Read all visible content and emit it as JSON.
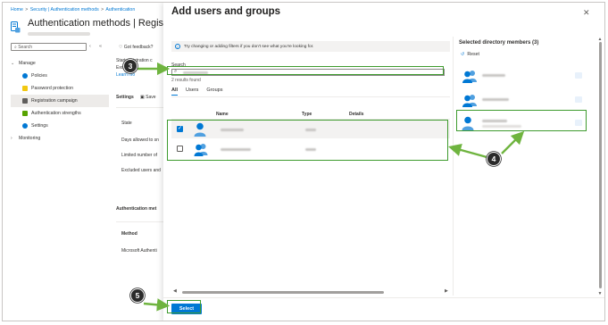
{
  "breadcrumb": {
    "home": "Home",
    "security": "Security | Authentication methods",
    "auth": "Authentication"
  },
  "page": {
    "title": "Authentication methods | Regist",
    "search_placeholder": "Search",
    "feedback": "Got feedback?"
  },
  "nav": {
    "manage": "Manage",
    "policies": "Policies",
    "password_protection": "Password protection",
    "registration_campaign": "Registration campaign",
    "authentication_strengths": "Authentication strengths",
    "settings": "Settings",
    "monitoring": "Monitoring"
  },
  "background": {
    "start_text": "Start registration c",
    "exclude_text": "Exclud",
    "learn_more": "Learn mo",
    "settings": "Settings",
    "save": "Save",
    "state": "State",
    "days_allowed": "Days allowed to sn",
    "limited_number": "Limited number of",
    "excluded_users": "Excluded users and",
    "auth_methods": "Authentication met",
    "method": "Method",
    "microsoft_authenticator": "Microsoft Authenti"
  },
  "dialog": {
    "title": "Add users and groups",
    "info": "Try changing or adding filters if you don't see what you're looking for.",
    "search_label": "Search",
    "results": "2 results found",
    "tabs": [
      "All",
      "Users",
      "Groups"
    ],
    "columns": {
      "name": "Name",
      "type": "Type",
      "details": "Details"
    },
    "selected_title": "Selected directory members (3)",
    "reset": "Reset",
    "select_button": "Select",
    "close_icon": "close-icon"
  },
  "annotations": {
    "step3": "3",
    "step4": "4",
    "step5": "5"
  },
  "colors": {
    "accent": "#0078d4",
    "annotation_green": "#3e9b2e",
    "callout": "#2b2b2b"
  }
}
